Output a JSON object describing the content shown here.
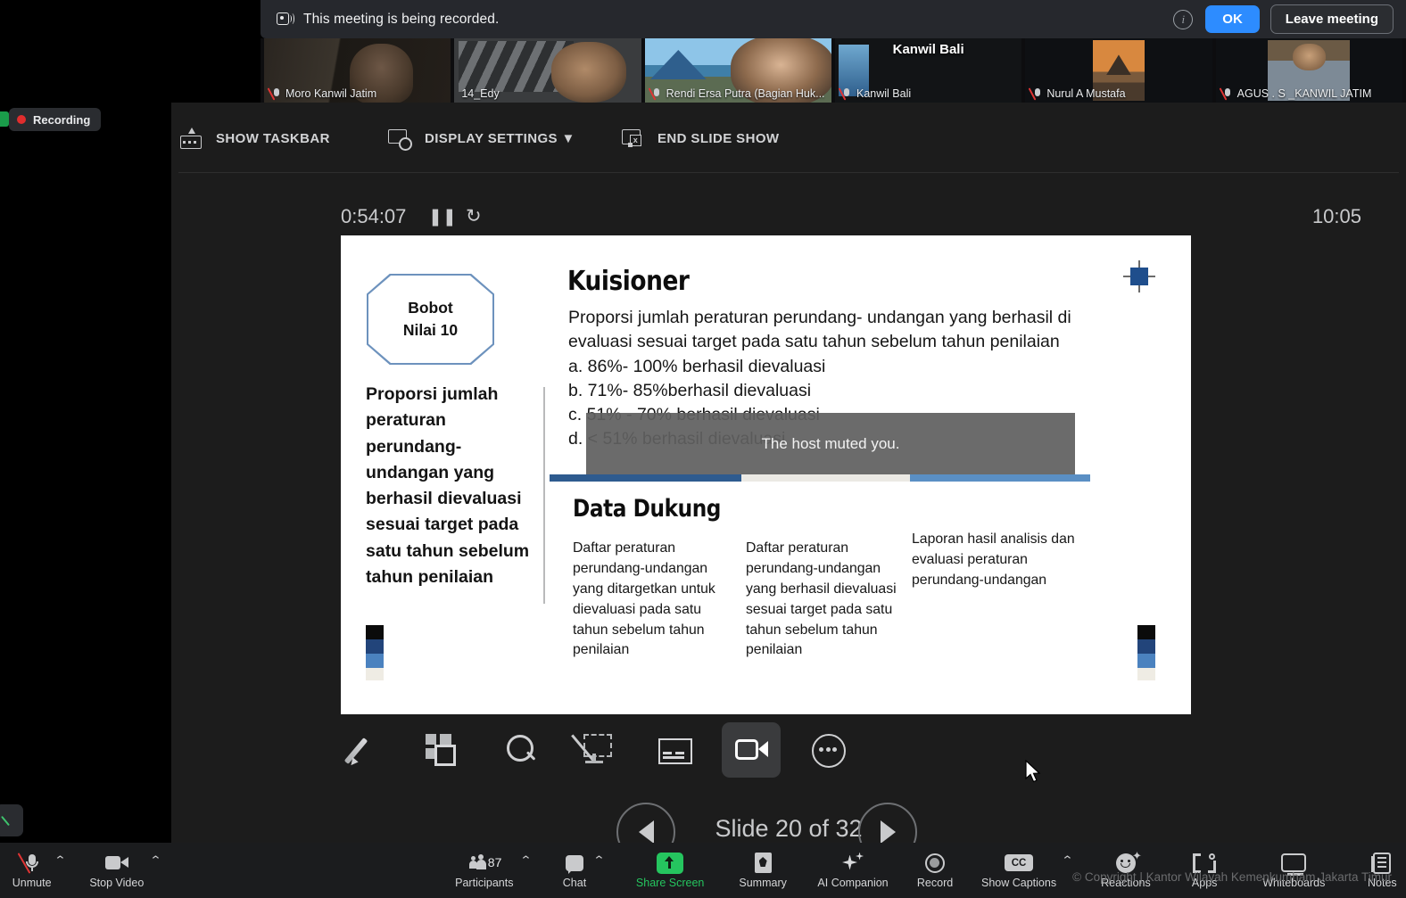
{
  "notification": {
    "message": "This meeting is being recorded.",
    "camera_icon": "recording-camera-icon",
    "info_icon": "info-icon",
    "ok_label": "OK",
    "leave_label": "Leave meeting"
  },
  "recording_pill": {
    "label": "Recording"
  },
  "participants_strip": [
    {
      "name": "Moro Kanwil Jatim",
      "muted": true,
      "active": false,
      "big_label": ""
    },
    {
      "name": "14_Edy",
      "muted": false,
      "active": true,
      "big_label": ""
    },
    {
      "name": "Rendi Ersa Putra (Bagian Huk...",
      "muted": true,
      "active": false,
      "big_label": ""
    },
    {
      "name": "Kanwil Bali",
      "muted": true,
      "active": false,
      "big_label": "Kanwil Bali"
    },
    {
      "name": "Nurul A Mustafa",
      "muted": true,
      "active": false,
      "big_label": ""
    },
    {
      "name": "AGUS . S _KANWIL JATIM",
      "muted": true,
      "active": false,
      "big_label": ""
    }
  ],
  "ppt_toolbar": [
    {
      "label": "SHOW TASKBAR",
      "icon": "show-taskbar-icon"
    },
    {
      "label": "DISPLAY SETTINGS ▼",
      "icon": "display-settings-icon"
    },
    {
      "label": "END SLIDE SHOW",
      "icon": "end-slide-show-icon"
    }
  ],
  "timer": {
    "elapsed": "0:54:07",
    "pause_glyph": "❚❚",
    "reset_glyph": "↻",
    "clock": "10:05"
  },
  "slide": {
    "badge_line1": "Bobot",
    "badge_line2": "Nilai 10",
    "left_text": "Proporsi jumlah peraturan perundang- undangan yang berhasil dievaluasi  sesuai target pada  satu tahun sebelum tahun penilaian",
    "title": "Kuisioner",
    "question": "Proporsi jumlah peraturan perundang-  undangan yang berhasil di evaluasi sesuai  target pada satu tahun sebelum tahun penilaian",
    "options": [
      "a. 86%- 100% berhasil dievaluasi",
      "b. 71%- 85%berhasil dievaluasi",
      "c. 51% - 70% berhasil dievaluasi",
      "d. < 51% berhasil dievaluasi"
    ],
    "divider_colors": [
      "#2e5b8f",
      "#ebe9e4",
      "#5a8fc4"
    ],
    "support_title": "Data Dukung",
    "support_columns": [
      "Daftar peraturan perundang-undangan  yang ditargetkan untuk dievaluasi pada satu tahun sebelum tahun penilaian",
      "Daftar peraturan perundang-undangan  yang berhasil  dievaluasi sesuai  target pada satu tahun sebelum tahun penilaian",
      "Laporan hasil analisis dan evaluasi peraturan perundang-undangan"
    ],
    "swatch_colors": [
      "#0b0b0b",
      "#22447a",
      "#4b82bf",
      "#efece4"
    ],
    "crosshair_color": "#1f4e8c"
  },
  "muted_toast": {
    "message": "The host muted you."
  },
  "annotate_tools": [
    {
      "name": "pen-tool",
      "selected": false
    },
    {
      "name": "slide-thumbnails-tool",
      "selected": false
    },
    {
      "name": "magnify-tool",
      "selected": false
    },
    {
      "name": "hide-slideshow-tool",
      "selected": false
    },
    {
      "name": "captions-tool",
      "selected": false
    },
    {
      "name": "camera-tool",
      "selected": true
    },
    {
      "name": "more-options-tool",
      "selected": false
    }
  ],
  "slide_nav": {
    "prev_icon": "previous-slide-icon",
    "next_icon": "next-slide-icon",
    "label": "Slide 20 of 32"
  },
  "zoom_bar": [
    {
      "label": "Unmute",
      "icon": "microphone-muted-icon",
      "caret": true,
      "green": false
    },
    {
      "label": "Stop Video",
      "icon": "camera-icon",
      "caret": true,
      "green": false
    },
    {
      "label": "Participants",
      "icon": "participants-icon",
      "caret": true,
      "green": false,
      "count": "87"
    },
    {
      "label": "Chat",
      "icon": "chat-icon",
      "caret": true,
      "green": false
    },
    {
      "label": "Share Screen",
      "icon": "share-screen-icon",
      "caret": false,
      "green": true
    },
    {
      "label": "Summary",
      "icon": "summary-icon",
      "caret": false,
      "green": false
    },
    {
      "label": "AI Companion",
      "icon": "ai-companion-icon",
      "caret": false,
      "green": false
    },
    {
      "label": "Record",
      "icon": "record-icon",
      "caret": false,
      "green": false
    },
    {
      "label": "Show Captions",
      "icon": "closed-captions-icon",
      "caret": true,
      "green": false
    },
    {
      "label": "Reactions",
      "icon": "reactions-icon",
      "caret": false,
      "green": false
    },
    {
      "label": "Apps",
      "icon": "apps-icon",
      "caret": false,
      "green": false
    },
    {
      "label": "Whiteboards",
      "icon": "whiteboards-icon",
      "caret": false,
      "green": false
    },
    {
      "label": "Notes",
      "icon": "notes-icon",
      "caret": false,
      "green": false
    }
  ],
  "copyright": "© Copyright | Kantor Wilayah Kemenkumham Jakarta Timur",
  "colors": {
    "accent_blue": "#2d8cff",
    "share_green": "#25c55f",
    "record_red": "#e02d2d"
  }
}
